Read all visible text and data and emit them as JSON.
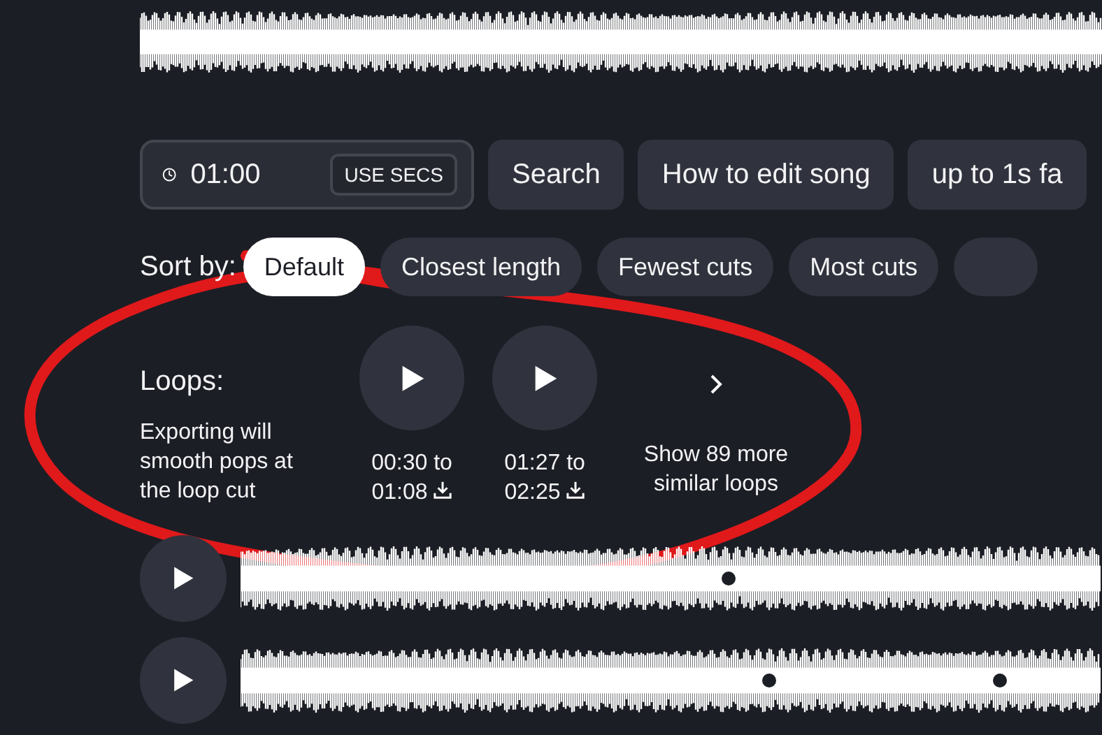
{
  "time_field": {
    "value": "01:00",
    "unit_button": "USE SECS"
  },
  "search_button": "Search",
  "suggestions": [
    "How to edit song",
    "up to 1s fa"
  ],
  "sort": {
    "label": "Sort by:",
    "options": [
      {
        "label": "Default",
        "selected": true
      },
      {
        "label": "Closest length",
        "selected": false
      },
      {
        "label": "Fewest cuts",
        "selected": false
      },
      {
        "label": "Most cuts",
        "selected": false
      }
    ]
  },
  "loops": {
    "title": "Loops:",
    "note": "Exporting will smooth pops at the loop cut",
    "items": [
      {
        "range": "00:30 to 01:08"
      },
      {
        "range": "01:27 to 02:25"
      }
    ],
    "more": "Show 89 more similar loops"
  },
  "tracks": [
    {
      "playing": false
    },
    {
      "playing": false
    }
  ]
}
